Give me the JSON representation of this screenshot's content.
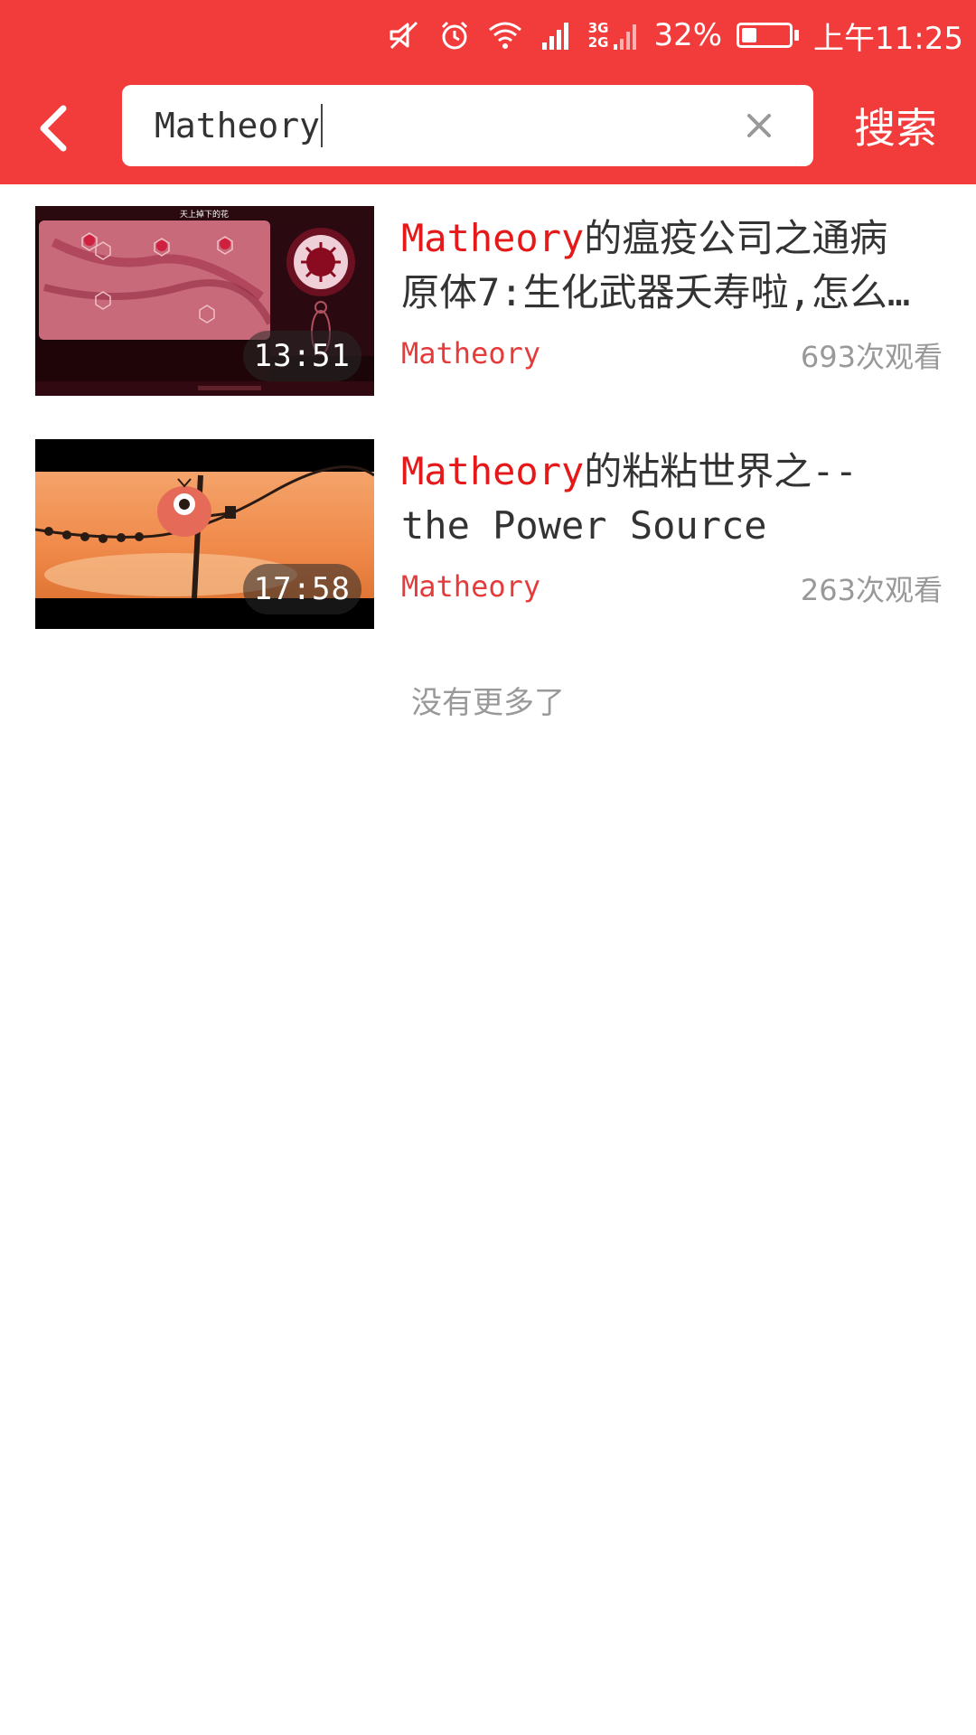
{
  "status_bar": {
    "battery_percent": "32%",
    "battery_level": 0.32,
    "time": "上午11:25",
    "network_top": "3G",
    "network_bottom": "2G",
    "icons": [
      "mute-icon",
      "alarm-icon",
      "wifi-icon",
      "signal-icon",
      "dual-sim-signal-icon",
      "battery-icon"
    ]
  },
  "search": {
    "query": "Matheory",
    "submit_label": "搜索"
  },
  "results": [
    {
      "title_highlight": "Matheory",
      "title_line1_rest": "的瘟疫公司之通病",
      "title_line2": "原体7:生化武器夭寿啦,怎么…",
      "duration": "13:51",
      "uploader": "Matheory",
      "views": "693次观看",
      "thumbnail": {
        "caption": "天上掉下的花",
        "theme_color": "#c0304a"
      }
    },
    {
      "title_highlight": "Matheory",
      "title_line1_rest": "的粘粘世界之--",
      "title_line2": "the Power Source",
      "duration": "17:58",
      "uploader": "Matheory",
      "views": "263次观看",
      "thumbnail": {
        "theme_color": "#f0934a"
      }
    }
  ],
  "end_message": "没有更多了",
  "colors": {
    "brand_red": "#f23c3c",
    "highlight_red": "#e51919",
    "muted_text": "#999999"
  }
}
